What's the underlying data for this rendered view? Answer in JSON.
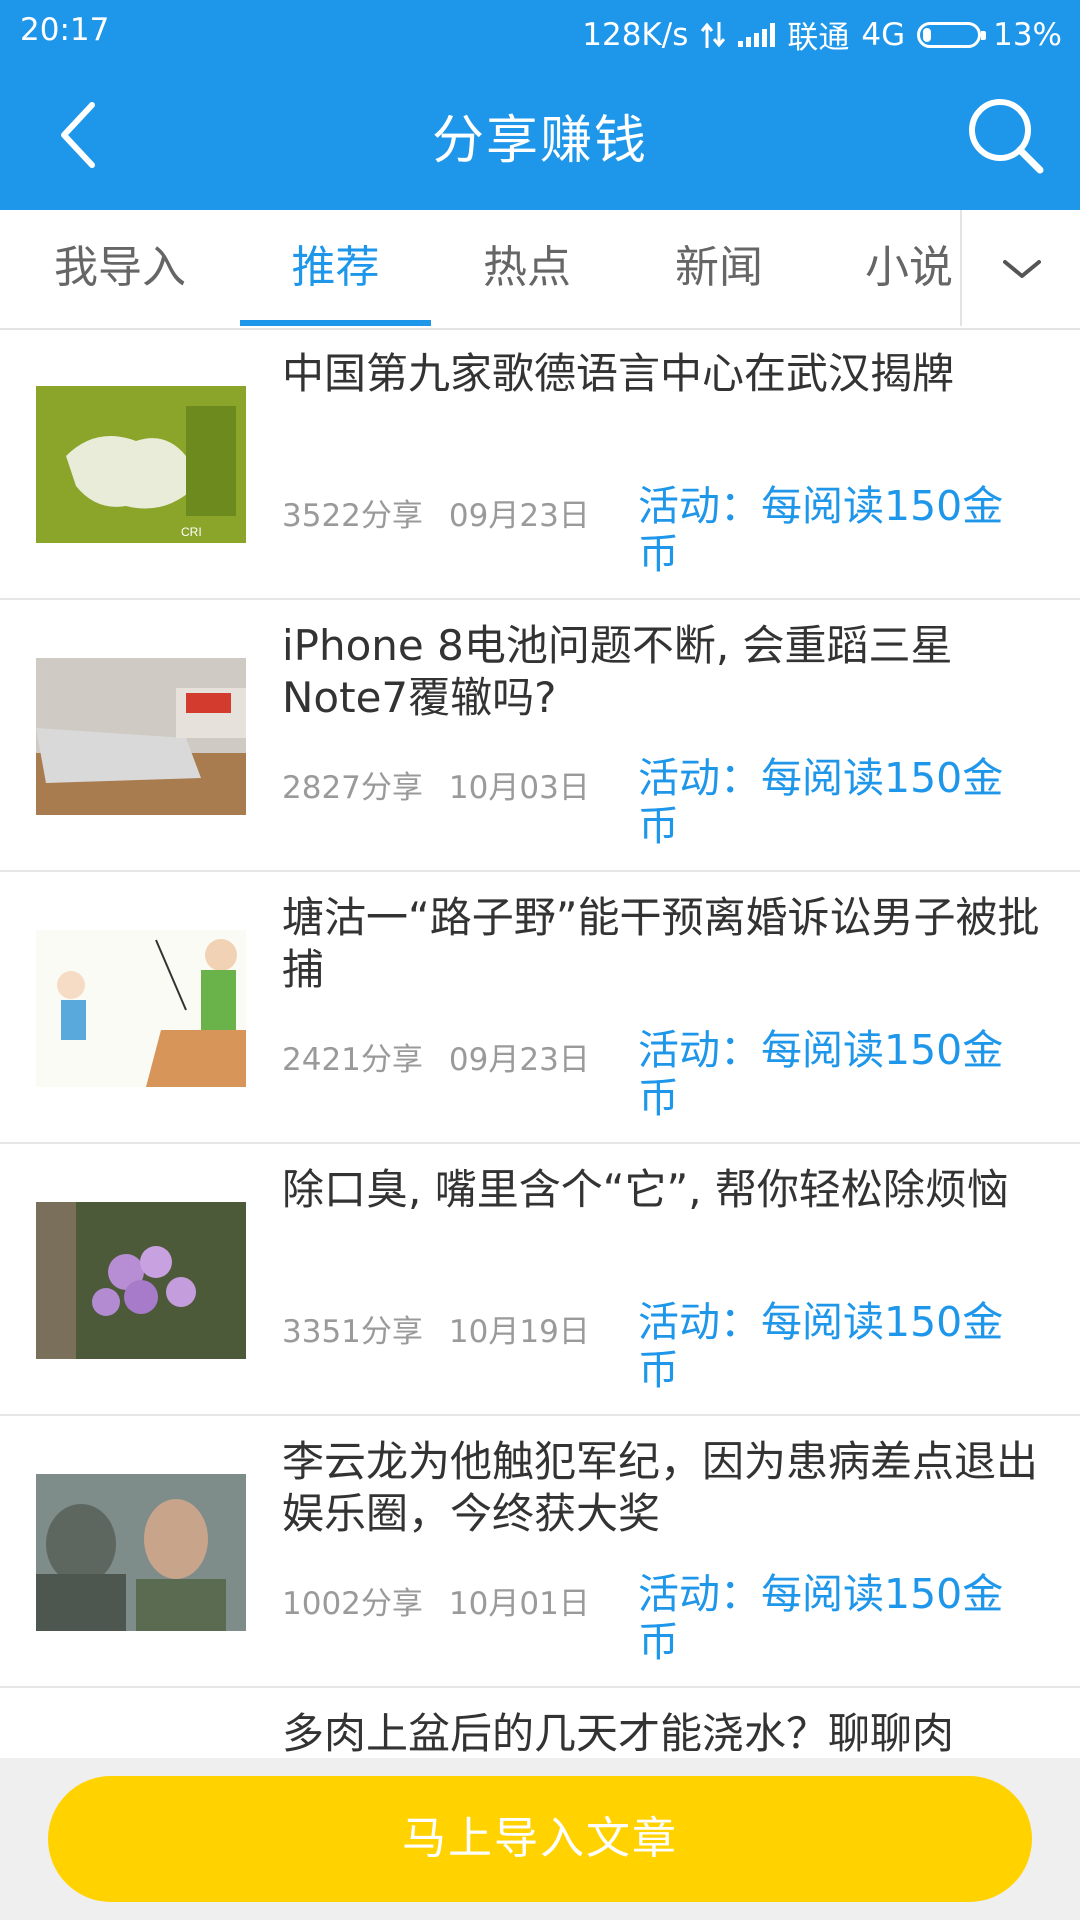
{
  "status_bar": {
    "time": "20:17",
    "speed": "128K/s",
    "carrier": "联通",
    "network": "4G",
    "battery": "13%"
  },
  "header": {
    "title": "分享赚钱",
    "back_icon": "chevron-left-icon",
    "search_icon": "search-icon"
  },
  "tabs": [
    {
      "label": "我导入",
      "active": false
    },
    {
      "label": "推荐",
      "active": true
    },
    {
      "label": "热点",
      "active": false
    },
    {
      "label": "新闻",
      "active": false
    },
    {
      "label": "小说",
      "active": false
    }
  ],
  "articles": [
    {
      "title": "中国第九家歌德语言中心在武汉揭牌",
      "shares": "3522分享",
      "date": "09月23日",
      "activity": "活动：每阅读150金币"
    },
    {
      "title": "iPhone 8电池问题不断, 会重蹈三星Note7覆辙吗?",
      "shares": "2827分享",
      "date": "10月03日",
      "activity": "活动：每阅读150金币"
    },
    {
      "title": "塘沽一“路子野”能干预离婚诉讼男子被批捕",
      "shares": "2421分享",
      "date": "09月23日",
      "activity": "活动：每阅读150金币"
    },
    {
      "title": "除口臭, 嘴里含个“它”, 帮你轻松除烦恼",
      "shares": "3351分享",
      "date": "10月19日",
      "activity": "活动：每阅读150金币"
    },
    {
      "title": "李云龙为他触犯军纪，因为患病差点退出娱乐圈，今终获大奖",
      "shares": "1002分享",
      "date": "10月01日",
      "activity": "活动：每阅读150金币"
    },
    {
      "title": "多肉上盆后的几天才能浇水？聊聊肉",
      "shares": "",
      "date": "",
      "activity": ""
    }
  ],
  "bottom": {
    "import_label": "马上导入文章"
  },
  "colors": {
    "primary": "#1E96EA",
    "button": "#FFD200",
    "meta_text": "#9a9a9a"
  }
}
